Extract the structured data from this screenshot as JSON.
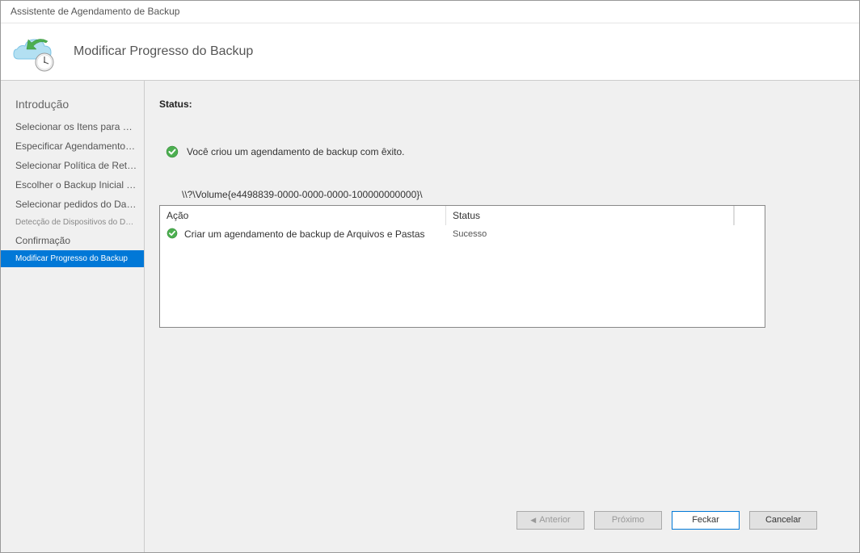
{
  "window": {
    "title": "Assistente de Agendamento de Backup"
  },
  "header": {
    "title": "Modificar Progresso do Backup"
  },
  "sidebar": {
    "items": [
      {
        "label": "Introdução",
        "style": "intro"
      },
      {
        "label": "Selecionar os Itens para Backup",
        "style": ""
      },
      {
        "label": "Especificar Agendamento de Backup ...",
        "style": ""
      },
      {
        "label": "Selecionar Política de Retenção (F...",
        "style": ""
      },
      {
        "label": "Escolher o Backup Inicial Ty...",
        "style": ""
      },
      {
        "label": "Selecionar pedidos do Data Box",
        "style": ""
      },
      {
        "label": "Detecção de Dispositivos do Data Box",
        "style": "small"
      },
      {
        "label": "Confirmação",
        "style": ""
      },
      {
        "label": "Modificar Progresso do Backup",
        "style": "active"
      }
    ]
  },
  "content": {
    "status_label": "Status:",
    "status_message": "Você criou um agendamento de backup com êxito.",
    "volume_path": "\\\\?\\Volume{e4498839-0000-0000-0000-100000000000}\\",
    "table": {
      "headers": {
        "action": "Ação",
        "status": "Status"
      },
      "rows": [
        {
          "action": "Criar um agendamento de backup de Arquivos e Pastas",
          "status": "Sucesso"
        }
      ]
    }
  },
  "footer": {
    "previous": "Anterior",
    "next": "Próximo",
    "close": "Feckar",
    "cancel": "Cancelar"
  }
}
